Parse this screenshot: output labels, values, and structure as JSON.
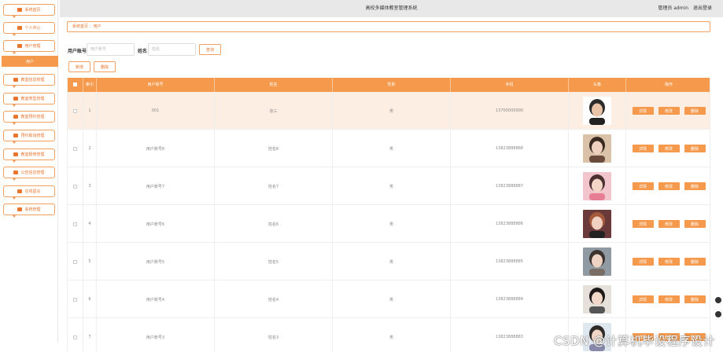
{
  "sidebar": {
    "items": [
      {
        "label": "系统首页",
        "icon": "home-icon",
        "active": false
      },
      {
        "label": "个人中心",
        "icon": "person-icon",
        "active": false
      },
      {
        "label": "用户管理",
        "icon": "users-icon",
        "active": false
      },
      {
        "label": "用户",
        "icon": "",
        "active": true
      },
      {
        "label": "教室信息管理",
        "icon": "grid-icon",
        "active": false
      },
      {
        "label": "教室类型管理",
        "icon": "list-icon",
        "active": false
      },
      {
        "label": "教室预约管理",
        "icon": "grid-icon",
        "active": false
      },
      {
        "label": "预约取消管理",
        "icon": "doc-icon",
        "active": false
      },
      {
        "label": "教室报修管理",
        "icon": "grid-icon",
        "active": false
      },
      {
        "label": "公告信息管理",
        "icon": "trophy-icon",
        "active": false
      },
      {
        "label": "在线留言",
        "icon": "grid-icon",
        "active": false
      },
      {
        "label": "系统管理",
        "icon": "grid-icon",
        "active": false
      }
    ]
  },
  "header": {
    "title": "高校多媒体教室管理系统",
    "role": "管理员 admin",
    "logout": "退出登录"
  },
  "breadcrumb": "系统首页 ：用户",
  "search": {
    "account_label": "用户账号",
    "account_placeholder": "用户账号",
    "name_label": "姓名",
    "name_placeholder": "姓名",
    "search_button": "查询"
  },
  "actions": {
    "add": "新增",
    "delete": "删除"
  },
  "table": {
    "headers": [
      "",
      "索引",
      "用户账号",
      "姓名",
      "性别",
      "手机",
      "头像",
      "操作"
    ],
    "rows": [
      {
        "index": "1",
        "account": "001",
        "name": "张三",
        "gender": "男",
        "phone": "13700000000"
      },
      {
        "index": "2",
        "account": "用户账号8",
        "name": "姓名8",
        "gender": "男",
        "phone": "13823888888"
      },
      {
        "index": "3",
        "account": "用户账号7",
        "name": "姓名7",
        "gender": "男",
        "phone": "13823888887"
      },
      {
        "index": "4",
        "account": "用户账号6",
        "name": "姓名6",
        "gender": "男",
        "phone": "13823888886"
      },
      {
        "index": "5",
        "account": "用户账号5",
        "name": "姓名5",
        "gender": "男",
        "phone": "13823888885"
      },
      {
        "index": "6",
        "account": "用户账号4",
        "name": "姓名4",
        "gender": "男",
        "phone": "13823888884"
      },
      {
        "index": "7",
        "account": "用户账号3",
        "name": "姓名3",
        "gender": "男",
        "phone": "13823888883"
      }
    ],
    "op_detail": "详情",
    "op_edit": "修改",
    "op_delete": "删除"
  },
  "watermark": "CSDN @计算机毕设程序设计",
  "colors": {
    "accent": "#f59a4c",
    "accent_text": "#e8762e",
    "row_highlight": "#fdeee3",
    "topbar": "#e8e8e8"
  }
}
